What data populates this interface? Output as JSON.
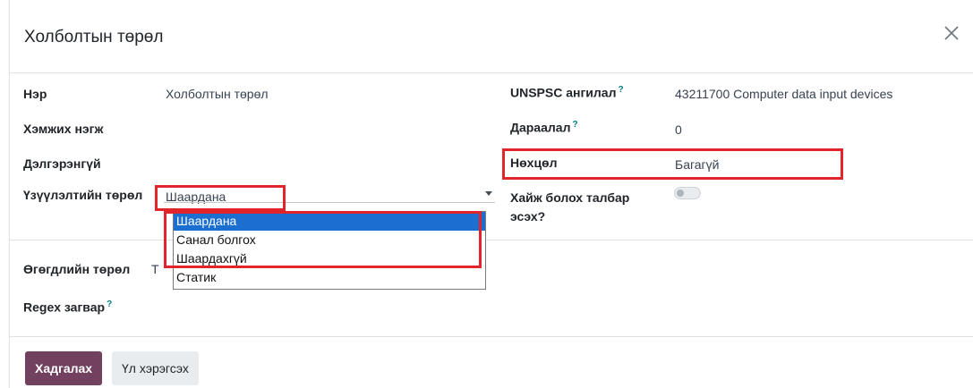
{
  "dialog": {
    "title": "Холболтын төрөл",
    "close_icon": "close-icon"
  },
  "fields": {
    "name_label": "Нэр",
    "name_value": "Холболтын төрөл",
    "uom_label": "Хэмжих нэгж",
    "detail_label": "Дэлгэрэнгүй",
    "display_type_label": "Үзүүлэлтийн төрөл",
    "display_type_value": "Шаардана",
    "data_type_label": "Өгөгдлийн төрөл",
    "data_type_partial": "Т",
    "regex_label": "Regex загвар",
    "regex_help": "?",
    "unspsc_label": "UNSPSC ангилал",
    "unspsc_help": "?",
    "unspsc_value": "43211700 Computer data input devices",
    "sequence_label": "Дараалал",
    "sequence_help": "?",
    "sequence_value": "0",
    "condition_label": "Нөхцөл",
    "condition_value": "Багагүй",
    "searchable_label_line1": "Хайж болох талбар",
    "searchable_label_line2": "эсэх?",
    "searchable_enabled": false
  },
  "dropdown": {
    "options": [
      "Шаардана",
      "Санал болгох",
      "Шаардахгүй",
      "Статик"
    ],
    "selected_index": 0
  },
  "footer": {
    "save_label": "Хадгалах",
    "discard_label": "Үл хэрэгсэх"
  },
  "colors": {
    "primary": "#71415f",
    "highlight": "#e1252b",
    "selected_option": "#1a6fd1",
    "help_mark": "#017e84"
  }
}
